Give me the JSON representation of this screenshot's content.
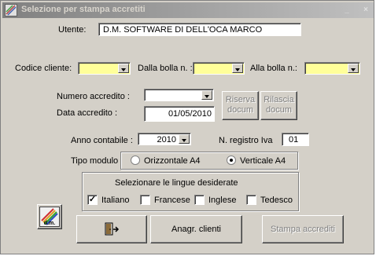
{
  "window": {
    "title": "Selezione per stampa accretiti",
    "minimize": "_",
    "close": "×"
  },
  "utente": {
    "label": "Utente:",
    "value": "D.M. SOFTWARE DI DELL'OCA MARCO"
  },
  "codice_cliente": {
    "label": "Codice cliente:",
    "value": ""
  },
  "dalla_bolla": {
    "label": "Dalla bolla n. :",
    "value": ""
  },
  "alla_bolla": {
    "label": "Alla bolla n.:",
    "value": ""
  },
  "numero_accredito": {
    "label": "Numero accredito :",
    "value": ""
  },
  "data_accredito": {
    "label": "Data accredito :",
    "value": "01/05/2010"
  },
  "riserva_button": {
    "line1": "Riserva",
    "line2": "docum"
  },
  "rilascia_button": {
    "line1": "Rilascia",
    "line2": "docum"
  },
  "anno_contabile": {
    "label": "Anno contabile :",
    "value": "2010"
  },
  "registro_iva": {
    "label": "N. registro Iva",
    "value": "01"
  },
  "tipo_modulo": {
    "label": "Tipo modulo",
    "options": [
      {
        "label": "Orizzontale A4",
        "selected": false
      },
      {
        "label": "Verticale A4",
        "selected": true
      }
    ]
  },
  "lingue": {
    "title": "Selezionare le lingue desiderate",
    "options": [
      {
        "label": "Italiano",
        "checked": true
      },
      {
        "label": "Francese",
        "checked": false
      },
      {
        "label": "Inglese",
        "checked": false
      },
      {
        "label": "Tedesco",
        "checked": false
      }
    ]
  },
  "logo": {
    "text": "d.m."
  },
  "buttons": {
    "anagr_clienti": "Anagr. clienti",
    "stampa_accrediti": "Stampa accrediti",
    "exit_icon": "exit-door-icon"
  },
  "colors": {
    "title_gradient_start": "#808080",
    "title_gradient_end": "#c0c0c0",
    "required_field": "#ffff99",
    "face": "#d4d0c8"
  }
}
